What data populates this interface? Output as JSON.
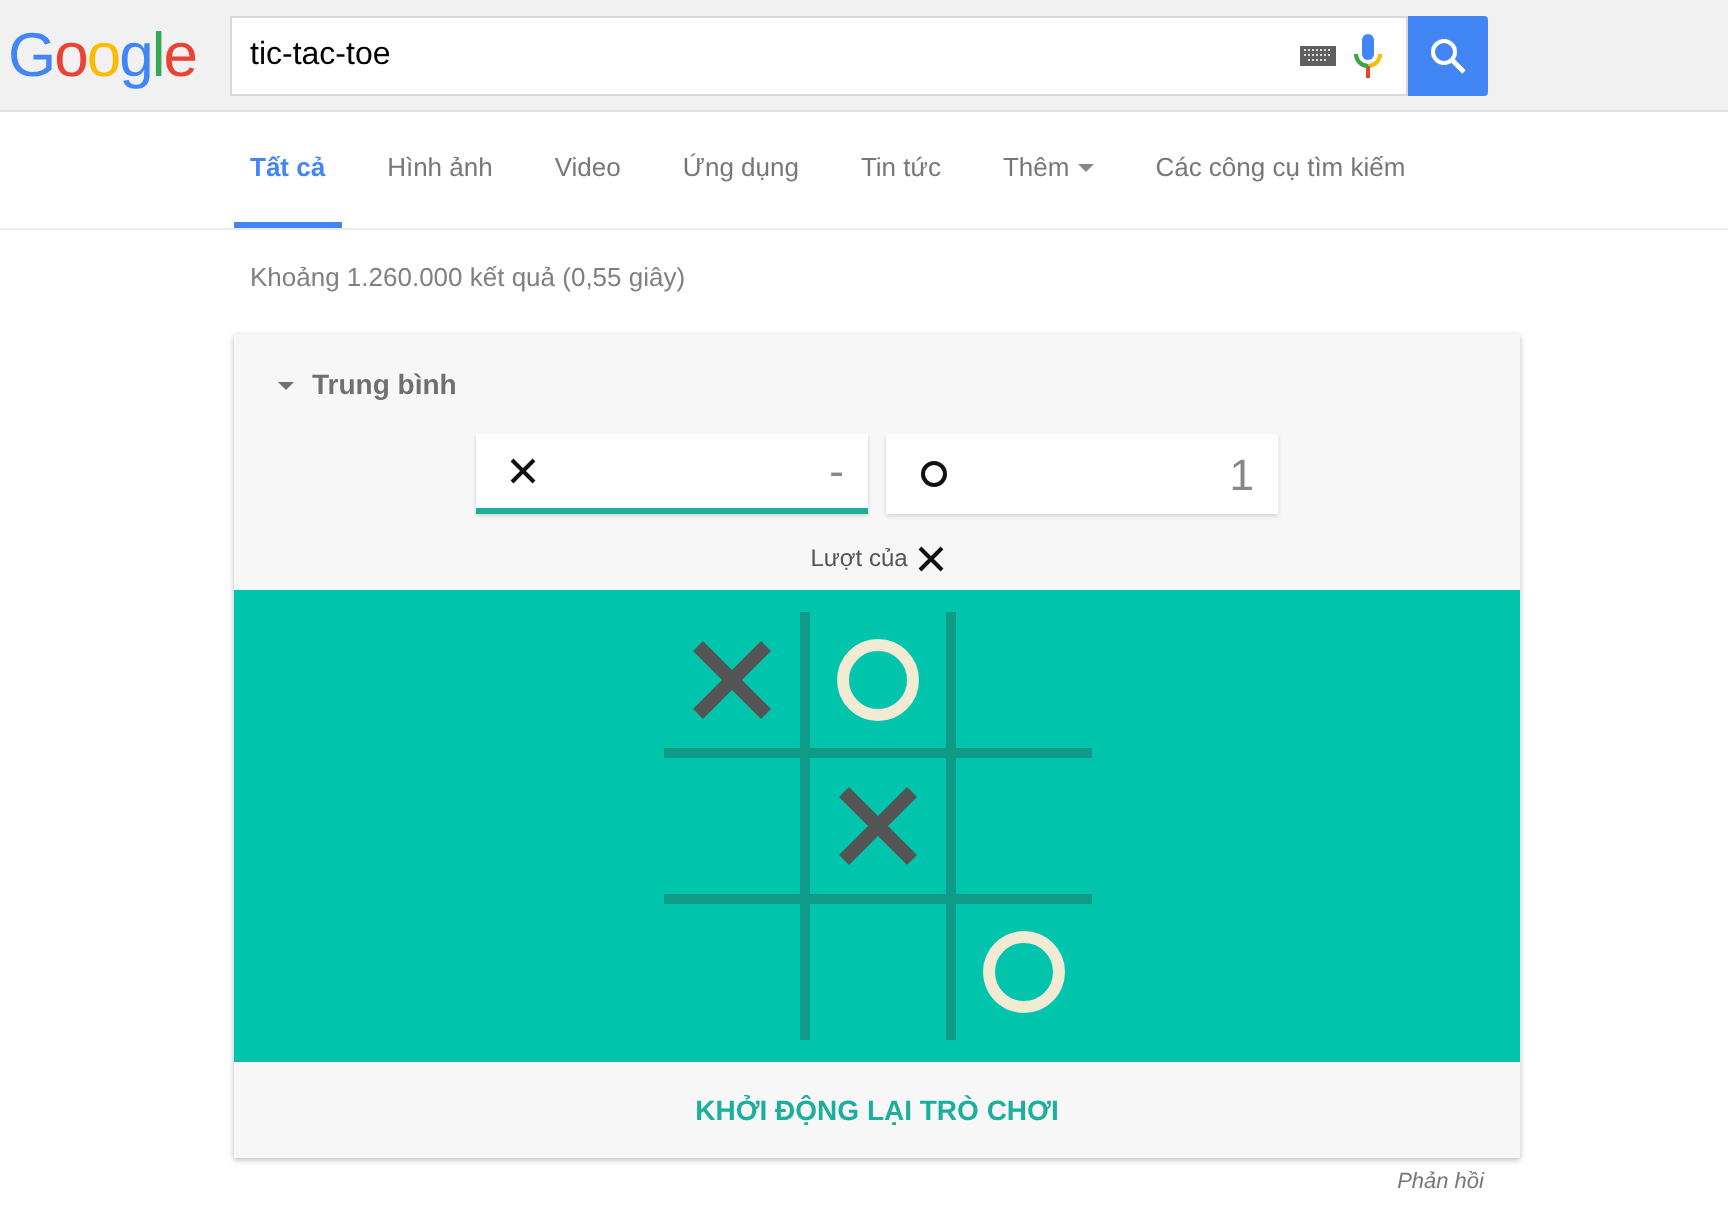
{
  "logo": "Google",
  "search": {
    "value": "tic-tac-toe"
  },
  "tabs": [
    {
      "label": "Tất cả",
      "selected": true
    },
    {
      "label": "Hình ảnh",
      "selected": false
    },
    {
      "label": "Video",
      "selected": false
    },
    {
      "label": "Ứng dụng",
      "selected": false
    },
    {
      "label": "Tin tức",
      "selected": false
    },
    {
      "label": "Thêm",
      "selected": false,
      "dropdown": true
    },
    {
      "label": "Các công cụ tìm kiếm",
      "selected": false
    }
  ],
  "result_stats": "Khoảng 1.260.000 kết quả (0,55 giây)",
  "game": {
    "difficulty": "Trung bình",
    "players": [
      {
        "kind": "x",
        "score": "-",
        "selected": true
      },
      {
        "kind": "o",
        "score": "1",
        "selected": false
      }
    ],
    "turn": {
      "label": "Lượt của",
      "kind": "x"
    },
    "board": [
      {
        "kind": "x"
      },
      {
        "kind": "o"
      },
      {
        "kind": "empty"
      },
      {
        "kind": "empty"
      },
      {
        "kind": "x"
      },
      {
        "kind": "empty"
      },
      {
        "kind": "empty"
      },
      {
        "kind": "empty"
      },
      {
        "kind": "o"
      }
    ],
    "restart": "KHỞI ĐỘNG LẠI TRÒ CHƠI"
  },
  "feedback": "Phản hồi"
}
